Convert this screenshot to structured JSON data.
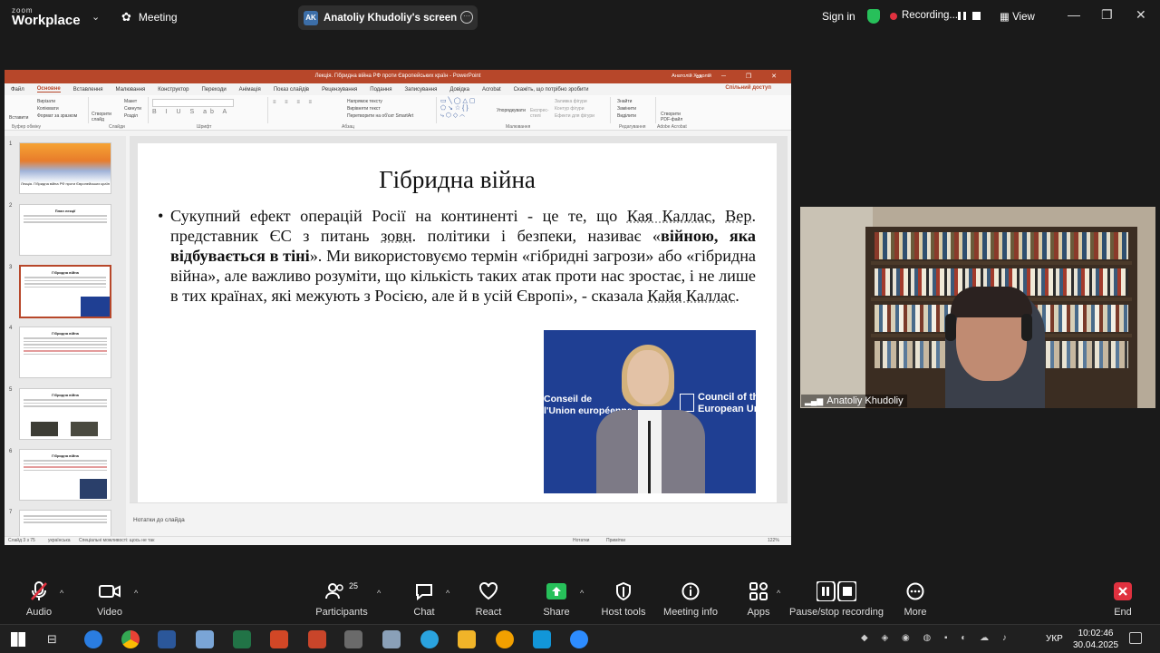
{
  "zoom": {
    "logo_top": "zoom",
    "logo_bottom": "Workplace",
    "meeting_label": "Meeting",
    "share_pill": {
      "initials": "AK",
      "label": "Anatoliy Khudoliy's screen"
    },
    "signin": "Sign in",
    "recording": "Recording...",
    "view": "View",
    "accent_green": "#27c05a",
    "record_red": "#e0313f"
  },
  "ppt": {
    "window_title": "Лекція. Гібридна війна РФ проти Європейських країн  -  PowerPoint",
    "user": "Анатолій Худолій",
    "menu": [
      "Файл",
      "Основне",
      "Вставлення",
      "Малювання",
      "Конструктор",
      "Переходи",
      "Анімація",
      "Показ слайдів",
      "Рецензування",
      "Подання",
      "Записування",
      "Довідка",
      "Acrobat"
    ],
    "tell_me": "Скажіть, що потрібно зробити",
    "share": "Спільний доступ",
    "ribbon": {
      "paste": "Вставити",
      "cut": "Вирізати",
      "copy": "Копіювати",
      "format_painter": "Формат за зразком",
      "new_slide": "Створити слайд",
      "layout": "Макет",
      "reset": "Скинути",
      "section": "Розділ",
      "text_direction": "Напрямок тексту",
      "align_text": "Вирівняти текст",
      "convert_smartart": "Перетворити на об'єкт SmartArt",
      "arrange": "Упорядкувати",
      "quick_styles": "Експрес-стилі",
      "shape_fill": "Заливка фігури",
      "shape_outline": "Контур фігури",
      "shape_effects": "Ефекти для фігури",
      "find": "Знайти",
      "replace": "Замінити",
      "select": "Виділити",
      "create_pdf": "Створити PDF-файл",
      "groups": [
        "Буфер обміну",
        "Слайди",
        "Шрифт",
        "Абзац",
        "Малювання",
        "Редагування",
        "Adobe Acrobat"
      ]
    },
    "thumbnails": [
      {
        "n": "1",
        "title": "Лекція. Гібридна війна РФ проти Європейських країн"
      },
      {
        "n": "2",
        "title": "План лекції"
      },
      {
        "n": "3",
        "title": "Гібридна війна"
      },
      {
        "n": "4",
        "title": "Гібридна війна"
      },
      {
        "n": "5",
        "title": "Гібридна війна"
      },
      {
        "n": "6",
        "title": "Гібридна війна"
      },
      {
        "n": "7",
        "title": ""
      }
    ],
    "slide": {
      "title": "Гібридна війна",
      "bullet_a": "Сукупний ефект операцій Росії на континенті - це те, що ",
      "kallas1": "Кая Каллас",
      "bullet_b": ", ",
      "ver": "Вер",
      "bullet_c": ". представник ЄС з питань ",
      "zovn": "зовн",
      "bullet_d": ". політики і безпеки, називає «",
      "bold": "війною, яка відбувається в тіні",
      "bullet_e": "». Ми використовуємо термін «гібридні загрози» або «гібридна війна», але важливо розуміти, що кількість таких атак проти нас зростає, і не лише в тих країнах, які межують з Росією, але й в усій Європі», - сказала ",
      "kallas2": "Кайя Каллас",
      "bullet_f": ".",
      "photo_left": "Conseil de\nl'Union européenne",
      "photo_right": "Council of the\nEuropean Union"
    },
    "notes": "Нотатки до слайда",
    "status": {
      "slide": "Слайд 3 з 75",
      "lang": "українська",
      "access": "Спеціальні можливості: щось не так",
      "notes_btn": "Нотатки",
      "comments": "Примітки",
      "zoom": "122%"
    },
    "accent": "#b7472a"
  },
  "video": {
    "name": "Anatoliy Khudoliy"
  },
  "toolbar": {
    "items": [
      {
        "key": "audio",
        "label": "Audio"
      },
      {
        "key": "video",
        "label": "Video"
      },
      {
        "key": "participants",
        "label": "Participants",
        "badge": "25"
      },
      {
        "key": "chat",
        "label": "Chat"
      },
      {
        "key": "react",
        "label": "React"
      },
      {
        "key": "share",
        "label": "Share"
      },
      {
        "key": "host",
        "label": "Host tools"
      },
      {
        "key": "info",
        "label": "Meeting info"
      },
      {
        "key": "apps",
        "label": "Apps"
      },
      {
        "key": "pause",
        "label": "Pause/stop recording"
      },
      {
        "key": "more",
        "label": "More"
      },
      {
        "key": "end",
        "label": "End"
      }
    ]
  },
  "taskbar": {
    "lang": "УКР",
    "time": "10:02:46",
    "date": "30.04.2025"
  }
}
